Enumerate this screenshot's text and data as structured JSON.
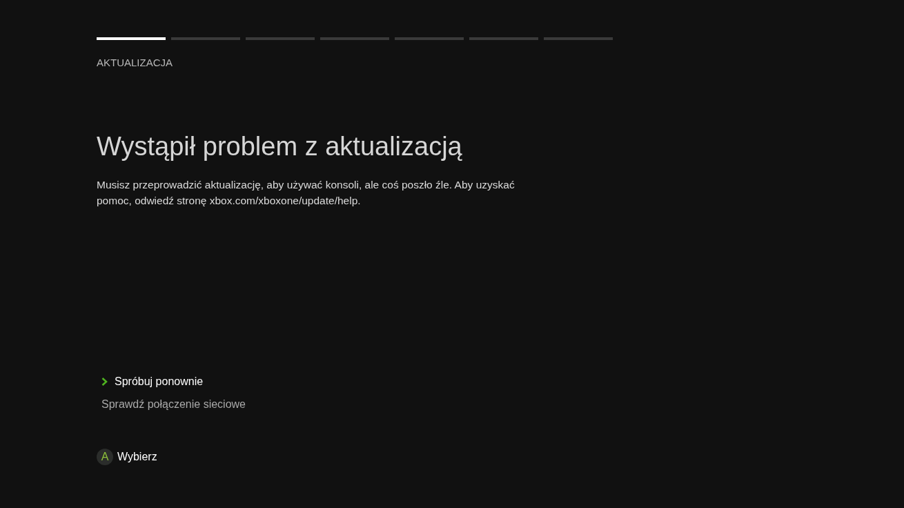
{
  "steps": [
    {
      "active": true
    },
    {
      "active": false
    },
    {
      "active": false
    },
    {
      "active": false
    },
    {
      "active": false
    },
    {
      "active": false
    },
    {
      "active": false
    }
  ],
  "section_label": "AKTUALIZACJA",
  "title": "Wystąpił problem z aktualizacją",
  "message": "Musisz przeprowadzić aktualizację, aby używać konsoli, ale coś poszło źle. Aby uzyskać pomoc, odwiedź stronę xbox.com/xboxone/update/help.",
  "options": [
    {
      "label": "Spróbuj ponownie",
      "selected": true
    },
    {
      "label": "Sprawdź połączenie sieciowe",
      "selected": false
    }
  ],
  "button_hint": {
    "key": "A",
    "label": "Wybierz"
  }
}
